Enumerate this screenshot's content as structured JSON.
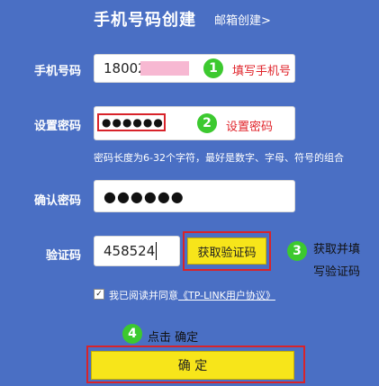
{
  "header": {
    "title": "手机号码创建",
    "email_link": "邮箱创建>"
  },
  "form": {
    "phone": {
      "label": "手机号码",
      "value": "18002"
    },
    "password": {
      "label": "设置密码",
      "value": "●●●●●●"
    },
    "password_hint": "密码长度为6-32个字符，最好是数字、字母、符号的组合",
    "confirm": {
      "label": "确认密码",
      "value": "●●●●●●"
    },
    "captcha": {
      "label": "验证码",
      "value": "458524",
      "button": "获取验证码"
    },
    "agree_prefix": "我已阅读并同意",
    "agree_link": "《TP-LINK用户协议》",
    "submit": "确 定"
  },
  "annotations": {
    "step1": {
      "number": "1",
      "text": "填写手机号"
    },
    "step2": {
      "number": "2",
      "text": "设置密码"
    },
    "step3": {
      "number": "3",
      "text_line1": "获取并填",
      "text_line2": "写验证码"
    },
    "step4": {
      "number": "4",
      "text": "点击 确定"
    }
  },
  "colors": {
    "background": "#4a6fc4",
    "badge": "#3cc92f",
    "highlight": "#d8232a",
    "button": "#f7e51a"
  }
}
